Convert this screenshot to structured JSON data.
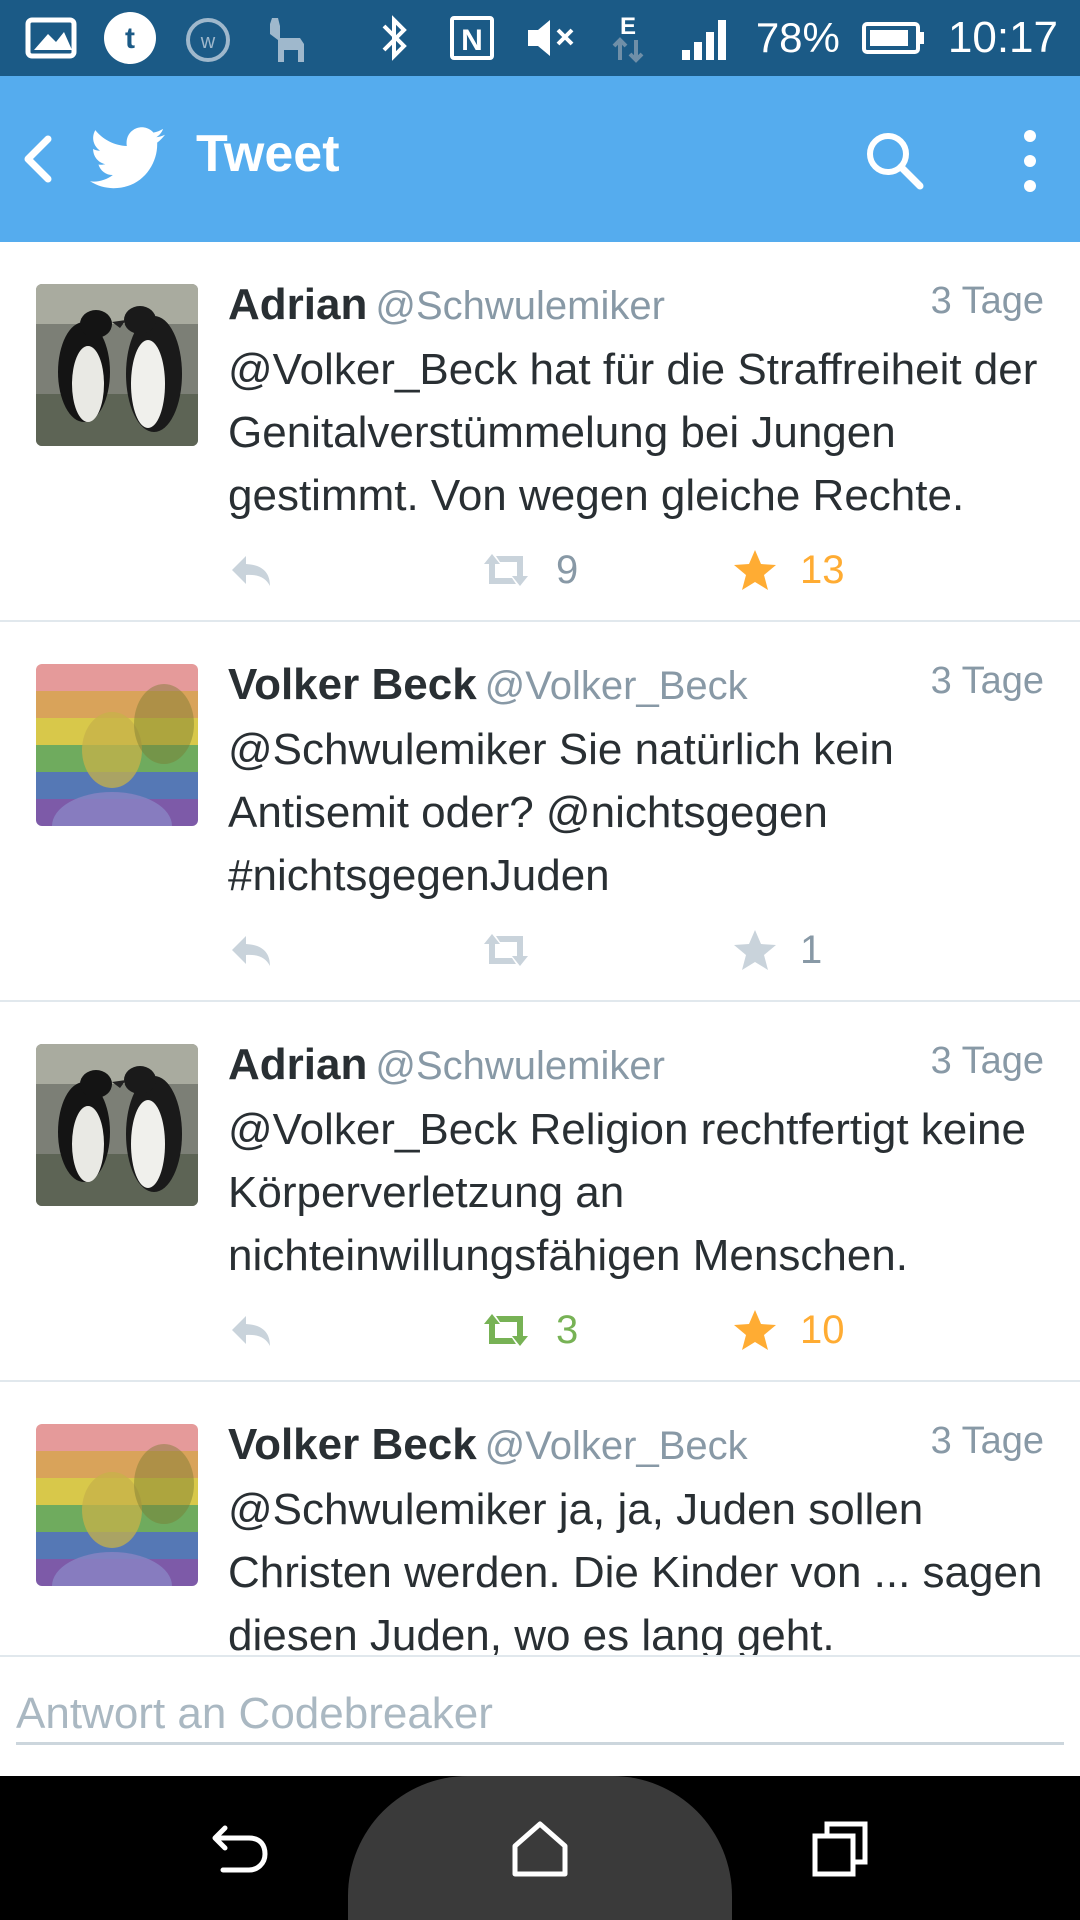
{
  "status_bar": {
    "battery": "78%",
    "time": "10:17",
    "network_type": "E",
    "icons": [
      "image-icon",
      "tumblr-icon",
      "alarm-w-icon",
      "llama-icon",
      "bluetooth-icon",
      "nfc-icon",
      "mute-icon",
      "network-e-icon",
      "signal-icon",
      "battery-icon"
    ]
  },
  "header": {
    "title": "Tweet",
    "background": "#55acee"
  },
  "tweets": [
    {
      "name": "Adrian",
      "handle": "@Schwulemiker",
      "time": "3 Tage",
      "text": "@Volker_Beck hat für die Straffreiheit der Genitalverstümmelung bei Jungen gestimmt. Von wegen gleiche Rechte.",
      "avatar": "penguins",
      "retweets": "9",
      "retweeted": false,
      "favorites": "13",
      "favorited": true
    },
    {
      "name": "Volker Beck",
      "handle": "@Volker_Beck",
      "time": "3 Tage",
      "text": "@Schwulemiker Sie natürlich kein Antisemit oder? @nichtsgegen #nichtsgegenJuden",
      "avatar": "rainbow-portrait",
      "retweets": "",
      "retweeted": false,
      "favorites": "1",
      "favorited": false
    },
    {
      "name": "Adrian",
      "handle": "@Schwulemiker",
      "time": "3 Tage",
      "text": "@Volker_Beck Religion rechtfertigt keine Körperverletzung an nichteinwillungsfähigen Menschen.",
      "avatar": "penguins",
      "retweets": "3",
      "retweeted": true,
      "favorites": "10",
      "favorited": true
    },
    {
      "name": "Volker Beck",
      "handle": "@Volker_Beck",
      "time": "3 Tage",
      "text": "@Schwulemiker ja, ja, Juden sollen Christen werden. Die Kinder von ... sagen diesen Juden, wo es lang geht.",
      "avatar": "rainbow-portrait",
      "retweets": "",
      "retweeted": false,
      "favorites": "",
      "favorited": false
    }
  ],
  "reply": {
    "placeholder": "Antwort an Codebreaker"
  },
  "colors": {
    "accent": "#55acee",
    "status_bar": "#1b5a86",
    "favorite": "#ffac33",
    "retweet": "#77b255",
    "meta_gray": "#8899a6"
  }
}
